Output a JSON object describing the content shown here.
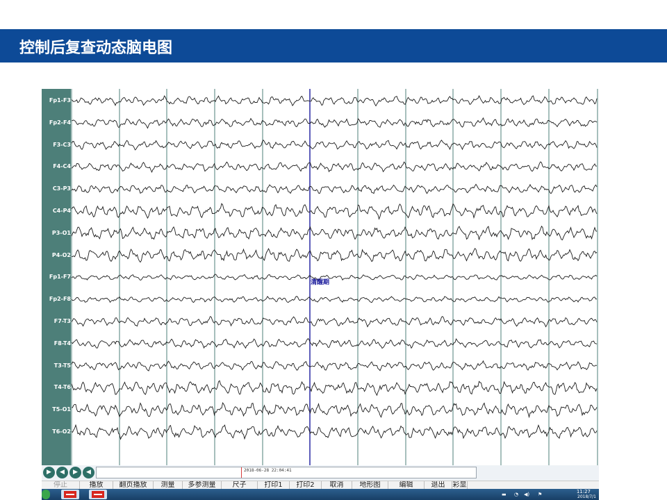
{
  "slide": {
    "title": "控制后复查动态脑电图",
    "accent_color": "#0d4a97"
  },
  "eeg": {
    "channels": [
      "Fp1-F3",
      "Fp2-F4",
      "F3-C3",
      "F4-C4",
      "C3-P3",
      "C4-P4",
      "P3-O1",
      "P4-O2",
      "Fp1-F7",
      "Fp2-F8",
      "F7-T3",
      "F8-T4",
      "T3-T5",
      "T4-T6",
      "T5-O1",
      "T6-O2"
    ],
    "marker_label": "清醒期",
    "trace_color": "#1a1a1a",
    "grid_color": "#4d7f79",
    "marker_color": "#1b1b9c"
  },
  "controls": {
    "timestamp": "2018-06-28 22:04:41",
    "buttons": [
      "play-icon",
      "skip-back-icon",
      "forward-icon",
      "back-icon"
    ]
  },
  "menubar": {
    "items": [
      "停止",
      "播放",
      "翻页播放",
      "测量",
      "多参测量",
      "尺子",
      "打印1",
      "打印2",
      "取消",
      "地形图",
      "编辑",
      "退出",
      "彩显"
    ]
  },
  "taskbar": {
    "tray": {
      "time": "11:27",
      "date": "2018/7/1"
    }
  }
}
